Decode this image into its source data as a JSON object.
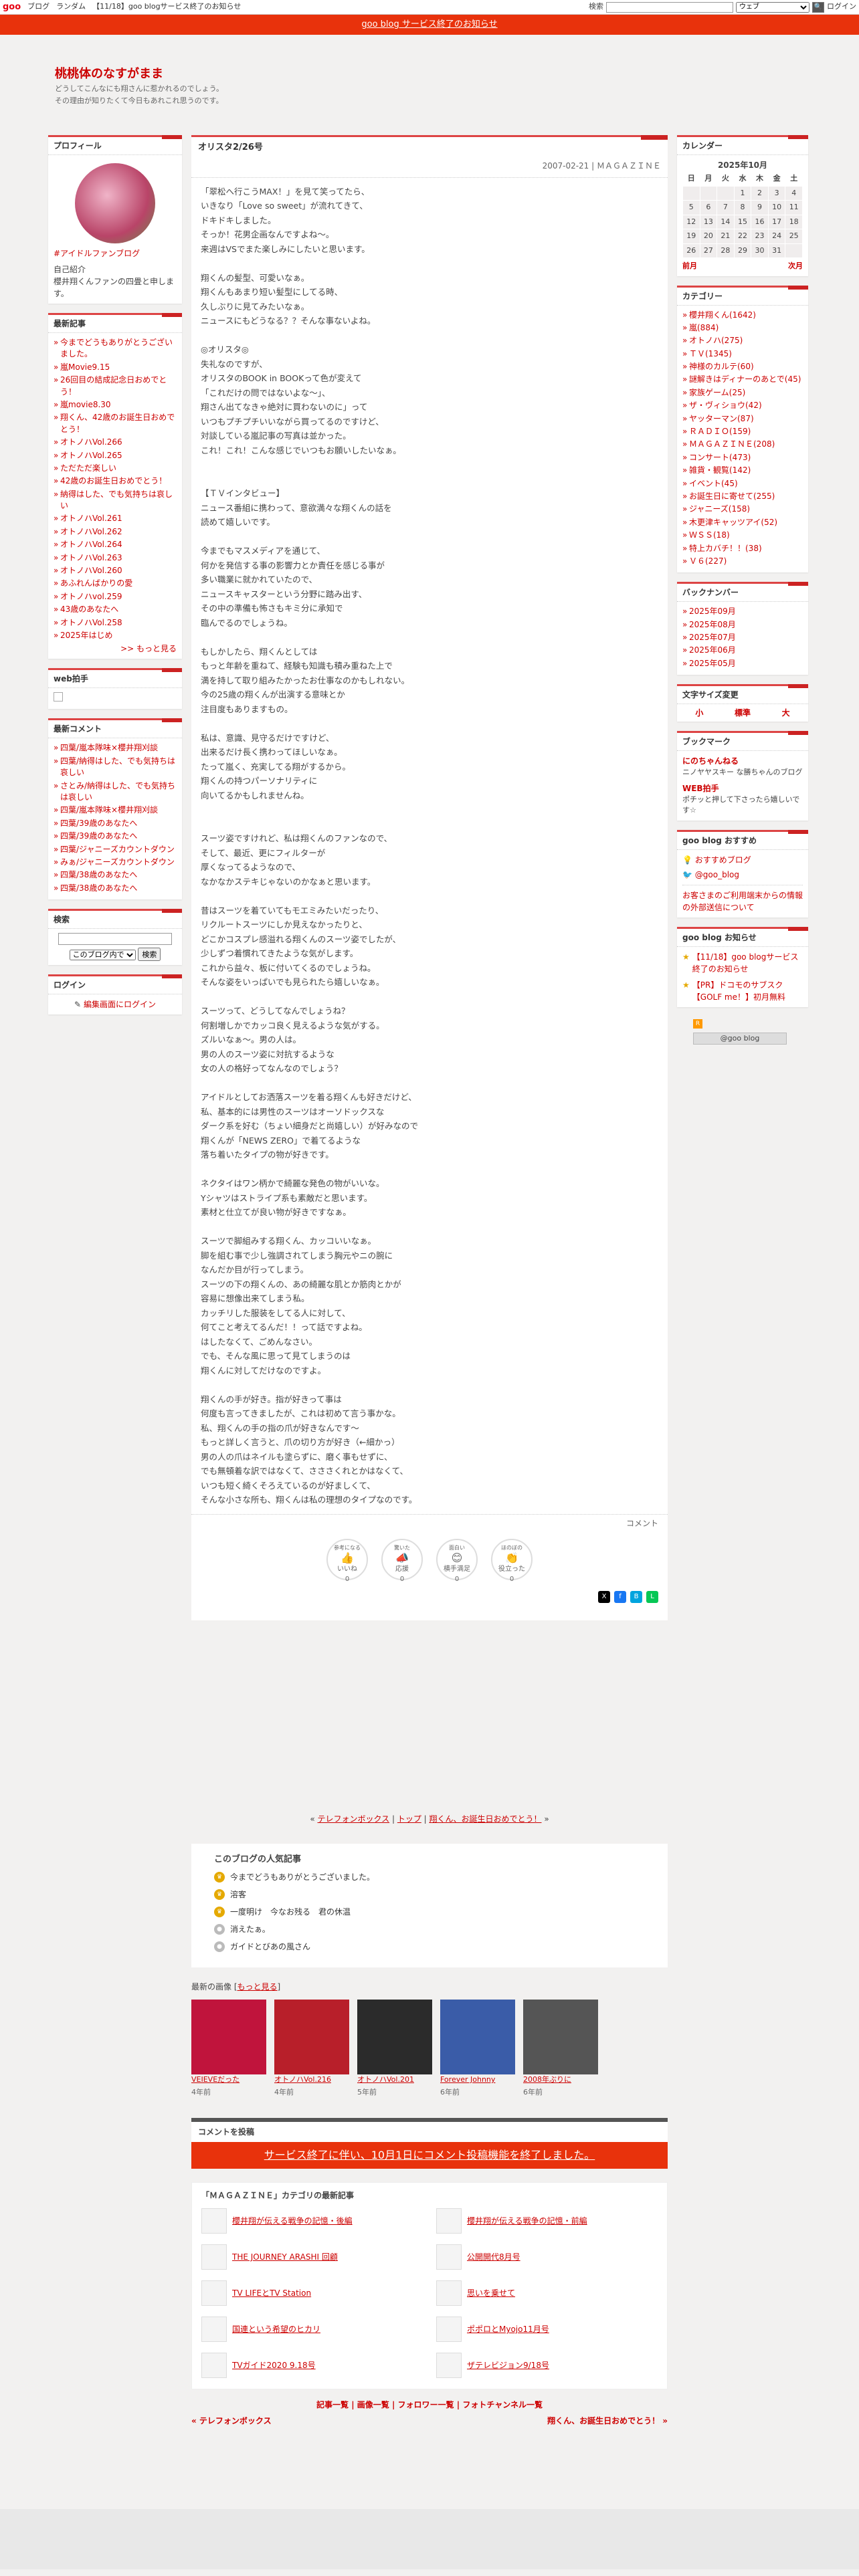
{
  "topbar": {
    "logo": "goo",
    "links": [
      "ブログ",
      "ランダム",
      "【11/18】goo blogサービス終了のお知らせ"
    ],
    "search_label": "検索",
    "search_scope": "ウェブ",
    "login": "ログイン"
  },
  "notice": "goo blog サービス終了のお知らせ",
  "blog": {
    "title": "桃桃体のなすがまま",
    "desc1": "どうしてこんなにも翔さんに惹かれるのでしょう。",
    "desc2": "その理由が知りたくて今日もあれこれ思うのです。"
  },
  "profile": {
    "heading": "プロフィール",
    "name_link": "#アイドルファンブログ",
    "intro_label": "自己紹介",
    "intro": "櫻井翔くんファンの四畳と申します。"
  },
  "recent": {
    "heading": "最新記事",
    "items": [
      "今までどうもありがとうございました。",
      "嵐Movie9.15",
      "26回目の結成記念日おめでとう！",
      "嵐movie8.30",
      "翔くん、42歳のお誕生日おめでとう！",
      "オトノハVol.266",
      "オトノハVol.265",
      "ただただ楽しい",
      "42歳のお誕生日おめでとう！",
      "納得はした、でも気持ちは哀しい",
      "オトノハVol.261",
      "オトノハVol.262",
      "オトノハVol.264",
      "オトノハVol.263",
      "オトノハVol.260",
      "あふれんばかりの愛",
      "オトノハvol.259",
      "43歳のあなたへ",
      "オトノハVol.258",
      "2025年はじめ"
    ],
    "more": ">> もっと見る"
  },
  "webclap": {
    "heading": "web拍手"
  },
  "comments": {
    "heading": "最新コメント",
    "items": [
      "四葉/嵐本隊味×櫻井翔刈談",
      "四葉/納得はした、でも気持ちは哀しい",
      "さとみ/納得はした、でも気持ちは哀しい",
      "四葉/嵐本隊味×櫻井翔刈談",
      "四葉/39歳のあなたへ",
      "四葉/39歳のあなたへ",
      "四葉/ジャニーズカウントダウン",
      "みぁ/ジャニーズカウントダウン",
      "四葉/38歳のあなたへ",
      "四葉/38歳のあなたへ"
    ]
  },
  "search": {
    "heading": "検索",
    "scope": "このブログ内で",
    "button": "検索"
  },
  "login": {
    "heading": "ログイン",
    "link": "編集画面にログイン"
  },
  "entry": {
    "title": "オリスタ2/26号",
    "meta": "2007-02-21 | ＭＡＧＡＺＩＮＥ",
    "body": "「翠松へ行こうMAX！」を見て笑ってたら、\nいきなり「Love so sweet」が流れてきて、\nドキドキしました。\nそっか！花男企画なんですよね〜。\n来週はVSでまた楽しみにしたいと思います。\n\n翔くんの髪型、可愛いなぁ。\n翔くんもあまり短い髪型にしてる時、\n久しぶりに見てみたいなぁ。\nニュースにもどうなる？？そんな事ないよね。\n\n◎オリスタ◎\n失礼なのですが、\nオリスタのBOOK in BOOKって色が変えて\n「これだけの問ではないよな〜」、\n翔さん出てなきゃ絶対に買わないのに」って\nいつもプチプチいいながら買ってるのですけど、\n対談している嵐記事の写真は並かった。\nこれ！これ！こんな感じでいつもお願いしたいなぁ。\n\n\n【ＴＶインタビュー】\nニュース番組に携わって、意欲満々な翔くんの話を\n読めて嬉しいです。\n\n今までもマスメディアを通じて、\n何かを発信する事の影響力とか責任を感じる事が\n多い職業に就かれていたので、\nニュースキャスターという分野に踏み出す、\nその中の準備も怖さもキミ分に承知で\n臨んでるのでしょうね。\n\nもしかしたら、翔くんとしては\nもっと年齢を重ねて、経験も知識も積み重ねた上で\n満を持して取り組みたかったお仕事なのかもしれない。\n今の25歳の翔くんが出演する意味とか\n注目度もありますもの。\n\n私は、意識、見守るだけですけど、\n出来るだけ長く携わってほしいなぁ。\nたって嵐く、充実してる翔がするから。\n翔くんの持つパーソナリティに\n向いてるかもしれませんね。\n\n\nスーツ姿ですけれど、私は翔くんのファンなので、\nそして、最近、更にフィルターが\n厚くなってるようなので、\nなかなかステキじゃないのかなぁと思います。\n\n昔はスーツを着ていてもモエミみたいだったり、\nリクルートスーツにしか見えなかったりと、\nどこかコスプレ感溢れる翔くんのスーツ姿でしたが、\n少しずつ着慣れてきたような気がします。\nこれから益々、板に付いてくるのでしょうね。\nそんな姿をいっぱいでも見られたら嬉しいなぁ。\n\nスーツって、どうしてなんでしょうね？\n何割増しかでカッコ良く見えるような気がする。\nズルいなぁ〜。男の人は。\n男の人のスーツ姿に対抗するような\n女の人の格好ってなんなのでしょう？\n\nアイドルとしてお洒落スーツを着る翔くんも好きだけど、\n私、基本的には男性のスーツはオーソドックスな\nダーク系を好む（ちょい細身だと尚嬉しい）が好みなので\n翔くんが「NEWS ZERO」で着てるような\n落ち着いたタイプの物が好きです。\n\nネクタイはワン柄かで綺麗な発色の物がいいな。\nYシャツはストライプ系も素敵だと思います。\n素材と仕立てが良い物が好きですなぁ。\n\nスーツで脚組みする翔くん、カッコいいなぁ。\n脚を組む事で少し強調されてしまう胸元やニの腕に\nなんだか目が行ってしまう。\nスーツの下の翔くんの、あの綺麗な肌とか筋肉とかが\n容易に想像出来てしまう私。\nカッチリした服装をしてる人に対して、\n何てこと考えてるんだ！！って話ですよね。\nはしたなくて、ごめんなさい。\nでも、そんな風に思って見てしまうのは\n翔くんに対してだけなのですよ。\n\n翔くんの手が好き。指が好きって事は\n何度も言ってきましたが、これは初めて言う事かな。\n私、翔くんの手の指の爪が好きなんです〜\nもっと詳しく言うと、爪の切り方が好き（←細かっ）\n男の人の爪はネイルも塗らずに、磨く事もせずに、\nでも無頓着な訳ではなくて、さささくれとかはなくて、\nいつも短く綺くそろえているのが好ましくて、\nそんな小さな所も、翔くんは私の理想のタイプなのです。",
    "comment_link": "コメント",
    "reactions": [
      {
        "title": "参考になる",
        "label": "いいね",
        "count": "0",
        "icon": "thumbs-up"
      },
      {
        "title": "驚いた",
        "label": "応援",
        "count": "0",
        "icon": "megaphone"
      },
      {
        "title": "面白い",
        "label": "横手満足",
        "count": "0",
        "icon": "smile"
      },
      {
        "title": "ほのぼの",
        "label": "役立った",
        "count": "0",
        "icon": "clap"
      }
    ]
  },
  "pagenav": {
    "prev": "テレフォンボックス",
    "top": "トップ",
    "next": "翔くん、お誕生日おめでとう！"
  },
  "popular": {
    "heading": "このブログの人気記事",
    "items": [
      "今までどうもありがとうございました。",
      "溶客",
      "一度明け　今なお残る　君の休温",
      "消えたぁ。",
      "ガイドとびあの風さん"
    ]
  },
  "images": {
    "heading": "最新の画像",
    "more": "もっと見る",
    "items": [
      {
        "title": "VEIEVEだった",
        "ago": "4年前"
      },
      {
        "title": "オトノハVol.216",
        "ago": "4年前"
      },
      {
        "title": "オトノハVol.201",
        "ago": "5年前"
      },
      {
        "title": "Forever Johnny",
        "ago": "6年前"
      },
      {
        "title": "2008年ぶりに",
        "ago": "6年前"
      }
    ]
  },
  "commentpost": {
    "heading": "コメントを投稿",
    "closed": "サービス終了に伴い、10月1日にコメント投稿機能を終了しました。"
  },
  "category_newest": {
    "heading": "「ＭＡＧＡＺＩＮＥ」カテゴリの最新記事",
    "items": [
      "櫻井翔が伝える戦争の記憶・後編",
      "櫻井翔が伝える戦争の記憶・前編",
      "THE JOURNEY ARASHI 回顧",
      "公開開代8月号",
      "TV LIFEとTV Station",
      "思いを乗せて",
      "国連という希望のヒカリ",
      "ポポロとMyojo11月号",
      "TVガイド2020 9.18号",
      "ザテレビジョン9/18号"
    ]
  },
  "footlinks": [
    "記事一覧",
    "画像一覧",
    "フォロワー一覧",
    "フォトチャンネル一覧"
  ],
  "prevnext": {
    "prev": "« テレフォンボックス",
    "next": "翔くん、お誕生日おめでとう！ »"
  },
  "calendar": {
    "heading": "カレンダー",
    "month": "2025年10月",
    "weekdays": [
      "日",
      "月",
      "火",
      "水",
      "木",
      "金",
      "土"
    ],
    "weeks": [
      [
        "",
        "",
        "",
        "1",
        "2",
        "3",
        "4"
      ],
      [
        "5",
        "6",
        "7",
        "8",
        "9",
        "10",
        "11"
      ],
      [
        "12",
        "13",
        "14",
        "15",
        "16",
        "17",
        "18"
      ],
      [
        "19",
        "20",
        "21",
        "22",
        "23",
        "24",
        "25"
      ],
      [
        "26",
        "27",
        "28",
        "29",
        "30",
        "31",
        ""
      ]
    ],
    "prev": "前月",
    "next": "次月"
  },
  "categories": {
    "heading": "カテゴリー",
    "items": [
      "櫻井翔くん(1642)",
      "嵐(884)",
      "オトノハ(275)",
      "ＴＶ(1345)",
      "神様のカルテ(60)",
      "謎解きはディナーのあとで(45)",
      "家族ゲーム(25)",
      "ザ・ヴィショウ(42)",
      "ヤッターマン(87)",
      "ＲＡＤＩＯ(159)",
      "ＭＡＧＡＺＩＮＥ(208)",
      "コンサート(473)",
      "雑貨・観覧(142)",
      "イベント(45)",
      "お誕生日に寄せて(255)",
      "ジャニーズ(158)",
      "木更津キャッツアイ(52)",
      "ＷＳＳ(18)",
      "特上カバチ！！(38)",
      "Ｖ６(227)"
    ]
  },
  "backnumber": {
    "heading": "バックナンバー",
    "items": [
      "2025年09月",
      "2025年08月",
      "2025年07月",
      "2025年06月",
      "2025年05月"
    ]
  },
  "textsize": {
    "heading": "文字サイズ変更",
    "small": "小",
    "normal": "標準",
    "large": "大"
  },
  "bookmark": {
    "heading": "ブックマーク",
    "items": [
      {
        "title": "にのちゃんねる",
        "desc": "ニノヤヤスキー な勝ちゃんのブログ"
      },
      {
        "title": "WEB拍手",
        "desc": "ポチッと押して下さったら嬉しいです☆"
      }
    ]
  },
  "gooblog": {
    "heading": "goo blog おすすめ",
    "items": [
      "おすすめブログ",
      "@goo_blog"
    ],
    "note": "お客さまのご利用端末からの情報の外部送信について"
  },
  "goonotice": {
    "heading": "goo blog お知らせ",
    "items": [
      "【11/18】goo blogサービス終了のお知らせ",
      "【PR】ドコモのサブスク【GOLF me！】初月無料"
    ]
  },
  "footer_badge": "@goo blog"
}
